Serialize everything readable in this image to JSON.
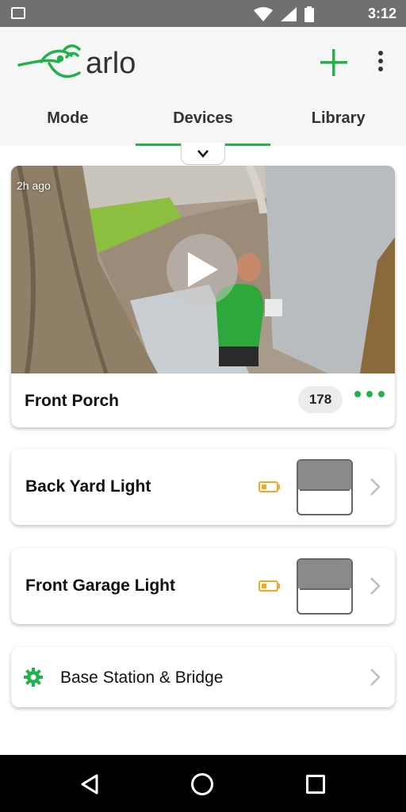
{
  "status_bar": {
    "time": "3:12"
  },
  "header": {
    "logo_text": "arlo",
    "tabs": [
      {
        "label": "Mode"
      },
      {
        "label": "Devices"
      },
      {
        "label": "Library"
      }
    ],
    "active_tab": "Devices"
  },
  "camera_card": {
    "time_ago": "2h ago",
    "name": "Front Porch",
    "clip_count": "178"
  },
  "lights": [
    {
      "name": "Back Yard Light",
      "battery_level": 0.25
    },
    {
      "name": "Front Garage Light",
      "battery_level": 0.25
    }
  ],
  "base_station": {
    "name": "Base Station & Bridge"
  },
  "colors": {
    "accent": "#21b24b",
    "battery_warning": "#f5a623",
    "status_bar": "#707070"
  },
  "icons": [
    "image-icon",
    "wifi-icon",
    "signal-icon",
    "battery-icon",
    "add-icon",
    "more-vert-icon",
    "chevron-down-icon",
    "play-icon",
    "more-horiz-icon",
    "low-battery-icon",
    "chevron-right-icon",
    "gear-icon",
    "back-icon",
    "home-icon",
    "recents-icon"
  ]
}
